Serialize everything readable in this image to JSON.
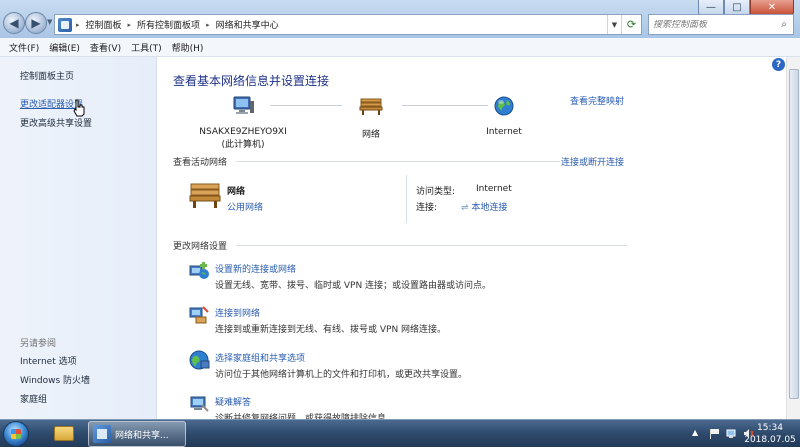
{
  "window": {
    "min_label": "—",
    "max_label": "□",
    "close_label": "✕"
  },
  "address": {
    "crumbs": [
      "控制面板",
      "所有控制面板项",
      "网络和共享中心"
    ],
    "separator": "▸",
    "search_placeholder": "搜索控制面板"
  },
  "menu": {
    "items": [
      "文件(F)",
      "编辑(E)",
      "查看(V)",
      "工具(T)",
      "帮助(H)"
    ]
  },
  "sidebar": {
    "home": "控制面板主页",
    "items": [
      {
        "label": "更改适配器设置"
      },
      {
        "label": "更改高级共享设置"
      }
    ],
    "see_also_label": "另请参阅",
    "see_also": [
      "Internet 选项",
      "Windows 防火墙",
      "家庭组"
    ]
  },
  "main": {
    "title": "查看基本网络信息并设置连接",
    "see_full_map": "查看完整映射",
    "map": {
      "computer_name": "NSAKXE9ZHEYO9XI",
      "computer_sub": "(此计算机)",
      "network": "网络",
      "internet": "Internet"
    },
    "active_label": "查看活动网络",
    "connect_disconnect": "连接或断开连接",
    "active_network": {
      "name": "网络",
      "type": "公用网络",
      "access_type_label": "访问类型:",
      "access_type_value": "Internet",
      "connections_label": "连接:",
      "connections_value": "本地连接"
    },
    "change_label": "更改网络设置",
    "tasks": [
      {
        "link": "设置新的连接或网络",
        "desc": "设置无线、宽带、拨号、临时或 VPN 连接；或设置路由器或访问点。"
      },
      {
        "link": "连接到网络",
        "desc": "连接到或重新连接到无线、有线、拨号或 VPN 网络连接。"
      },
      {
        "link": "选择家庭组和共享选项",
        "desc": "访问位于其他网络计算机上的文件和打印机，或更改共享设置。"
      },
      {
        "link": "疑难解答",
        "desc": "诊断并修复网络问题，或获得故障排除信息。"
      }
    ]
  },
  "taskbar": {
    "active_task": "网络和共享...",
    "time": "15:34",
    "date": "2018.07.05"
  },
  "colors": {
    "link": "#2a5db0",
    "title": "#1e3287",
    "taskbar": "#2e4a6c"
  }
}
